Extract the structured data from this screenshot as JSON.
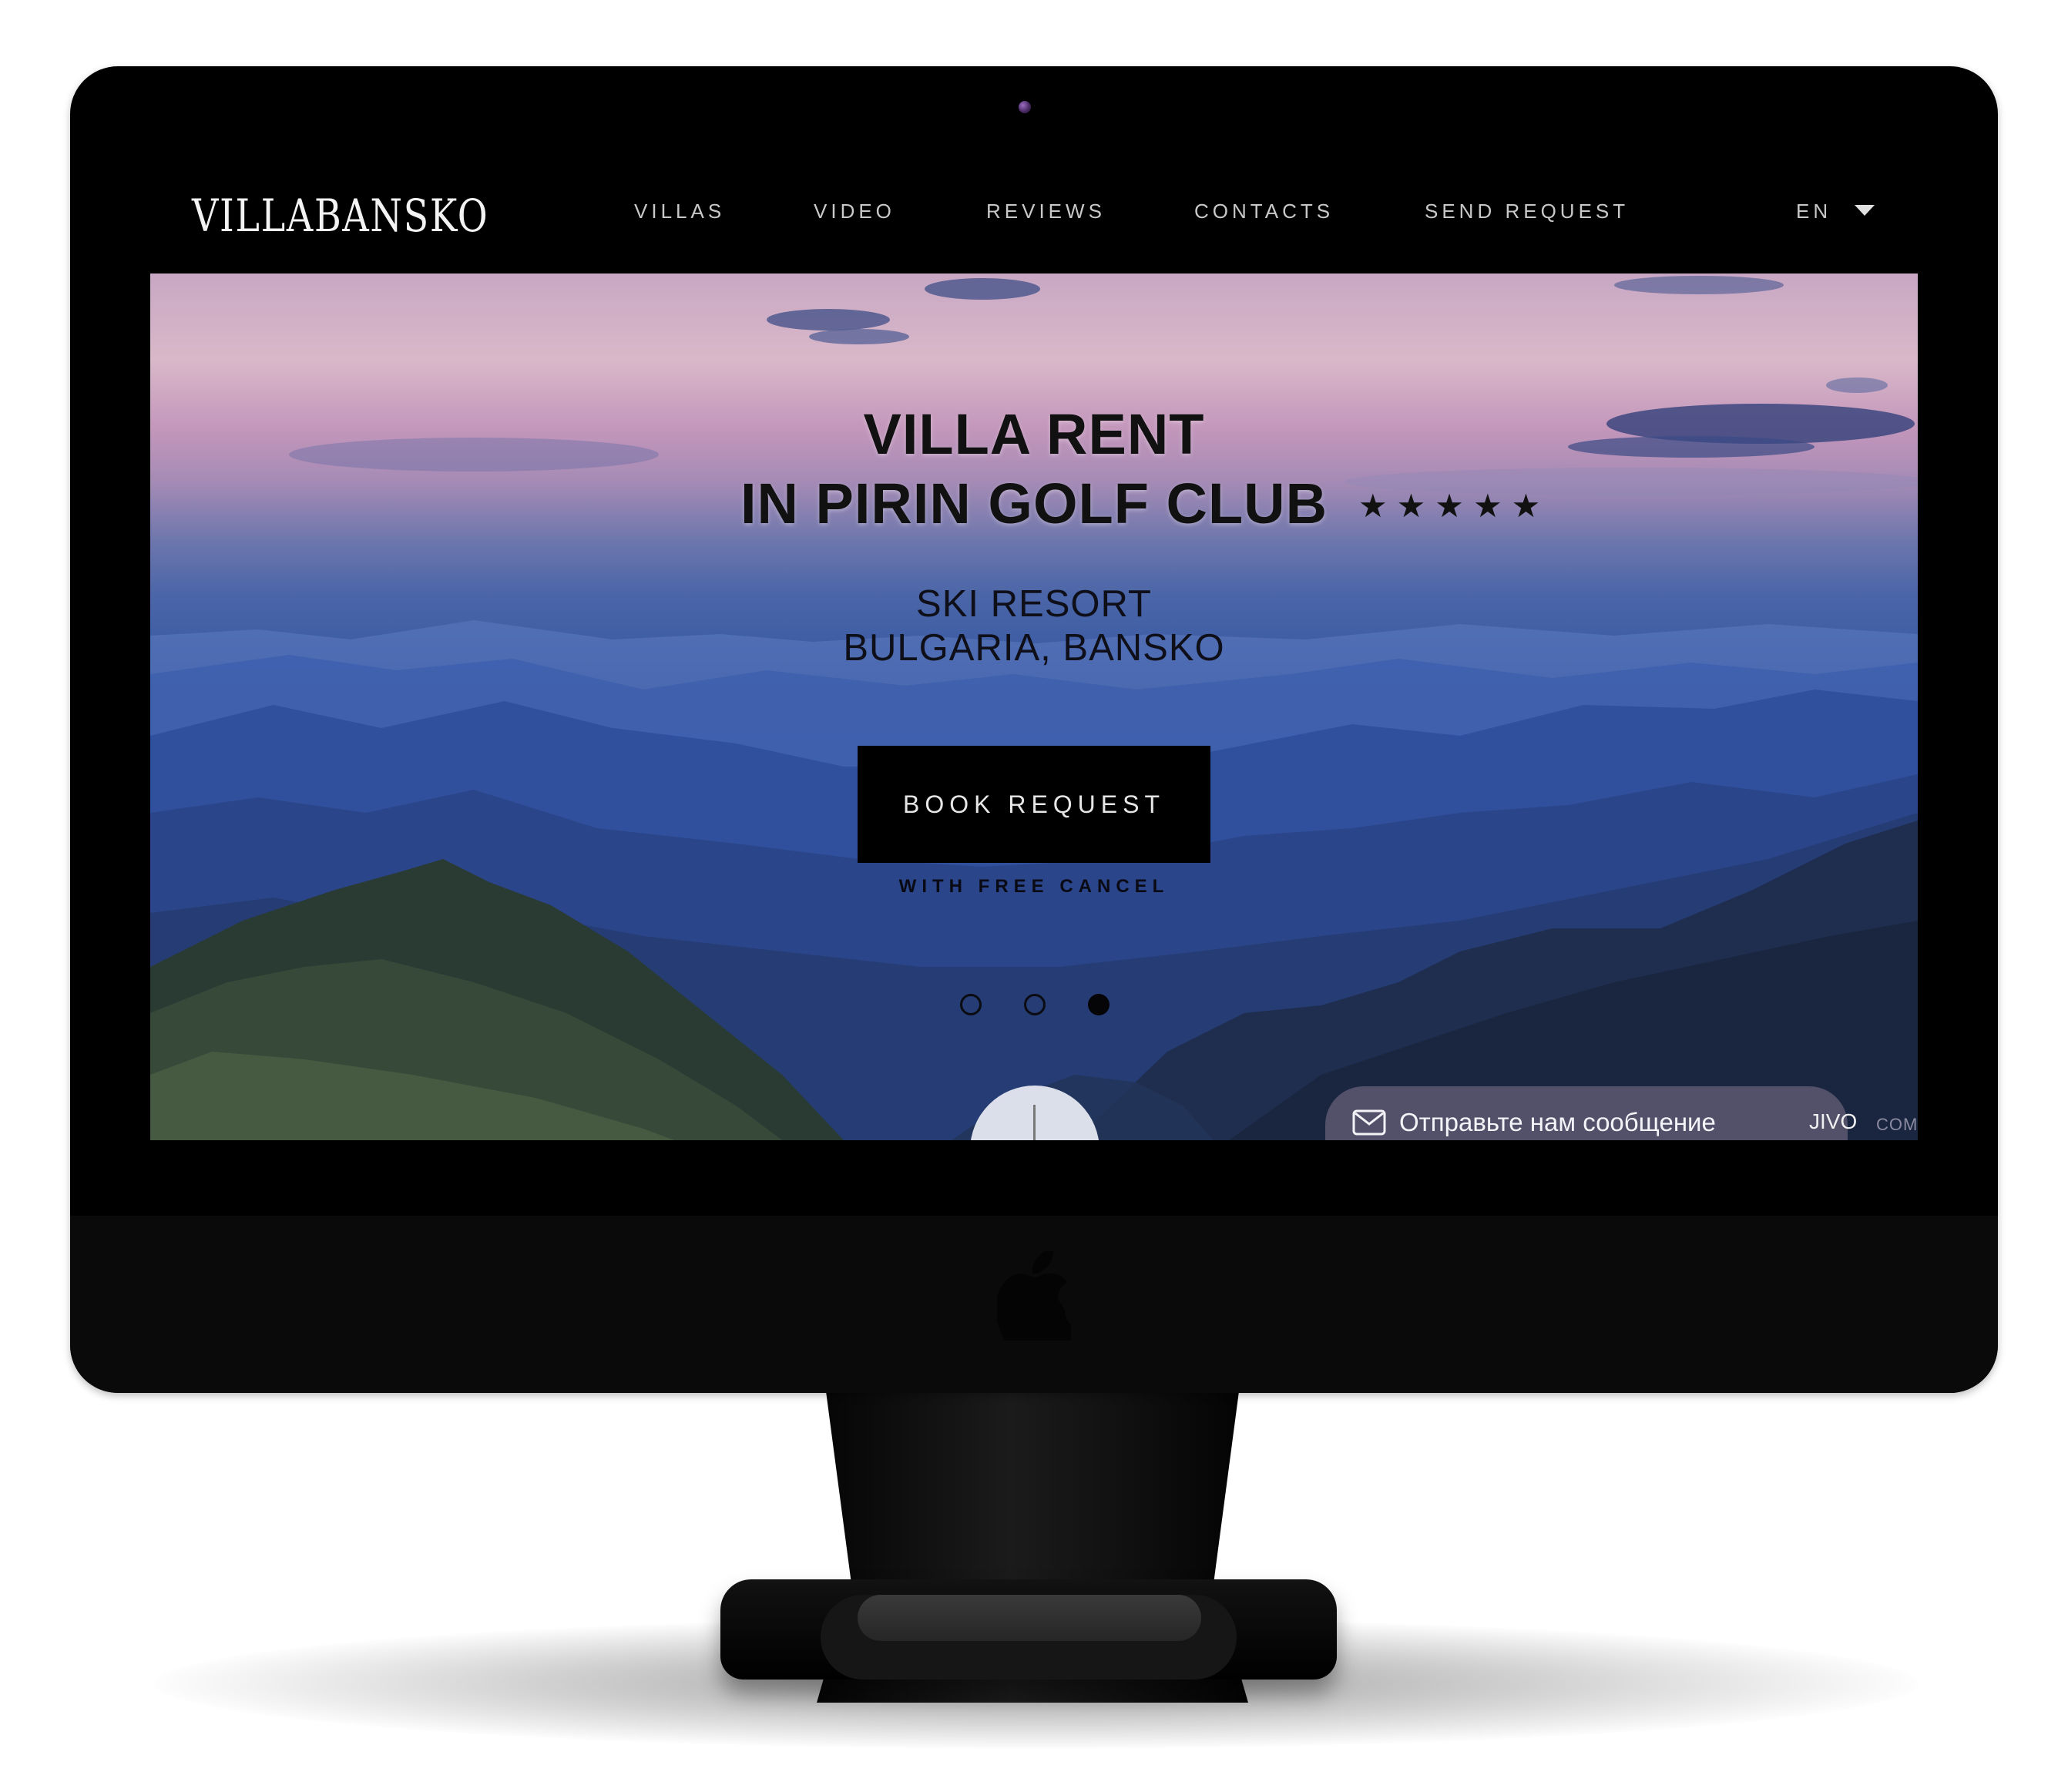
{
  "site": {
    "brand": "VILLABANSKO"
  },
  "nav": {
    "items": [
      {
        "label": "VILLAS"
      },
      {
        "label": "VIDEO"
      },
      {
        "label": "REVIEWS"
      },
      {
        "label": "CONTACTS"
      },
      {
        "label": "SEND REQUEST"
      }
    ],
    "language": "EN"
  },
  "hero": {
    "title_line1": "VILLA RENT",
    "title_line2": "IN PIRIN GOLF CLUB",
    "stars": "★★★★★",
    "subtitle_line1": "SKI RESORT",
    "subtitle_line2": "BULGARIA, BANSKO",
    "button_label": "BOOK REQUEST",
    "button_note": "WITH FREE CANCEL",
    "slides": {
      "count": 3,
      "active": 3
    }
  },
  "chat": {
    "message": "Отправьте нам сообщение",
    "brand": "JIVO",
    "suffix": "COM"
  },
  "colors": {
    "nav_background": "#000000",
    "nav_text": "#c8c8c8",
    "button_background": "#000000",
    "sky_top": "#c8a7c4",
    "mountains": "#3a5aa3",
    "chat_background": "#58546e"
  },
  "icons": {
    "language_caret": "caret-down-icon",
    "chat": "envelope-icon",
    "scroll": "scroll-down-icon",
    "device_logo": "apple-logo-icon",
    "camera": "camera-icon"
  }
}
